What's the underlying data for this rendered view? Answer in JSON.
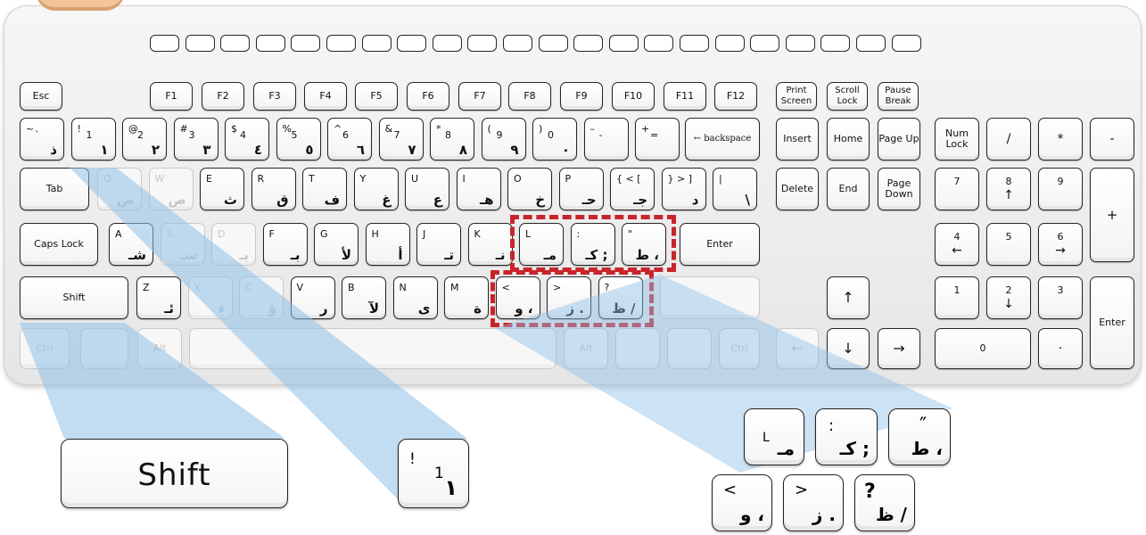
{
  "function_row": [
    "Esc",
    "F1",
    "F2",
    "F3",
    "F4",
    "F5",
    "F6",
    "F7",
    "F8",
    "F9",
    "F10",
    "F11",
    "F12"
  ],
  "system_keys": [
    "Print Screen",
    "Scroll Lock",
    "Pause Break"
  ],
  "number_row": [
    {
      "en": "~",
      "en2": "`",
      "ar": "ذ"
    },
    {
      "en": "!",
      "en2": "1",
      "ar": "١"
    },
    {
      "en": "@",
      "en2": "2",
      "ar": "٢"
    },
    {
      "en": "#",
      "en2": "3",
      "ar": "٣"
    },
    {
      "en": "$",
      "en2": "4",
      "ar": "٤"
    },
    {
      "en": "%",
      "en2": "5",
      "ar": "٥"
    },
    {
      "en": "^",
      "en2": "6",
      "ar": "٦"
    },
    {
      "en": "&",
      "en2": "7",
      "ar": "٧"
    },
    {
      "en": "*",
      "en2": "8",
      "ar": "٨"
    },
    {
      "en": "(",
      "en2": "9",
      "ar": "٩"
    },
    {
      "en": ")",
      "en2": "0",
      "ar": "٠"
    },
    {
      "en": "–",
      "en2": "-",
      "ar": ""
    },
    {
      "en": "+",
      "en2": "=",
      "ar": ""
    }
  ],
  "backspace_label": "backspace",
  "top_row": [
    {
      "en": "Q",
      "ar": "ض",
      "dim": true
    },
    {
      "en": "W",
      "ar": "ص",
      "dim": true
    },
    {
      "en": "E",
      "ar": "ث",
      "dim": false
    },
    {
      "en": "R",
      "ar": "ق",
      "dim": false
    },
    {
      "en": "T",
      "ar": "ف",
      "dim": false
    },
    {
      "en": "Y",
      "ar": "غ",
      "dim": false
    },
    {
      "en": "U",
      "ar": "ع",
      "dim": false
    },
    {
      "en": "I",
      "ar": "هـ",
      "dim": false
    },
    {
      "en": "O",
      "ar": "خ",
      "dim": false
    },
    {
      "en": "P",
      "ar": "حـ",
      "dim": false
    },
    {
      "en": "{  <  [",
      "ar": "جـ",
      "dim": false
    },
    {
      "en": "}  >  ]",
      "ar": "د",
      "dim": false
    },
    {
      "en": "|",
      "ar": "\\",
      "dim": false
    }
  ],
  "home_row": [
    {
      "en": "A",
      "ar": "شـ",
      "dim": false
    },
    {
      "en": "S",
      "ar": "سـ",
      "dim": true
    },
    {
      "en": "D",
      "ar": "يـ",
      "dim": true
    },
    {
      "en": "F",
      "ar": "بـ",
      "dim": false
    },
    {
      "en": "G",
      "ar": "لأ",
      "dim": false
    },
    {
      "en": "H",
      "ar": "أ",
      "dim": false
    },
    {
      "en": "J",
      "ar": "تـ",
      "dim": false
    },
    {
      "en": "K",
      "ar": "نـ",
      "dim": false
    },
    {
      "en": "L",
      "ar": "مـ",
      "dim": false
    },
    {
      "en": ":",
      "ar": "كـ ;",
      "dim": false
    },
    {
      "en": "\"",
      "ar": "ط ،",
      "dim": false
    }
  ],
  "bottom_row": [
    {
      "en": "Z",
      "ar": "ئـ",
      "dim": false
    },
    {
      "en": "X",
      "ar": "ء",
      "dim": true
    },
    {
      "en": "C",
      "ar": "ؤ",
      "dim": true
    },
    {
      "en": "V",
      "ar": "ر",
      "dim": false
    },
    {
      "en": "B",
      "ar": "لآ",
      "dim": false
    },
    {
      "en": "N",
      "ar": "ى",
      "dim": false
    },
    {
      "en": "M",
      "ar": "ة",
      "dim": false
    },
    {
      "en": "<",
      "ar": "و ،",
      "dim": false
    },
    {
      "en": ">",
      "ar": "ز .",
      "dim": false
    },
    {
      "en": "?",
      "ar": "ظ /",
      "dim": false
    }
  ],
  "mods": {
    "esc": "Esc",
    "tab": "Tab",
    "caps": "Caps Lock",
    "shift": "Shift",
    "enter": "Enter",
    "ctrl": "Ctrl",
    "alt": "Alt"
  },
  "nav": {
    "insert": "Insert",
    "home": "Home",
    "page_up": "Page Up",
    "delete": "Delete",
    "end": "End",
    "page_down": "Page Down",
    "up": "↑",
    "down": "↓",
    "right": "→",
    "left": "←"
  },
  "numpad": {
    "num_lock": "Num Lock",
    "slash": "/",
    "star": "*",
    "minus": "-",
    "plus": "+",
    "enter": "Enter",
    "n7": "7",
    "n8": "8",
    "n9": "9",
    "n4": "4",
    "n5": "5",
    "n6": "6",
    "n1": "1",
    "n2": "2",
    "n3": "3",
    "n0": "0",
    "dot": "·",
    "arr_up": "↑",
    "arr_left": "←",
    "arr_right": "→",
    "arr_down": "↓"
  },
  "callouts": {
    "shift_label": "Shift",
    "one_key": {
      "en": "!",
      "en2": "1",
      "ar": "١"
    },
    "l_key": {
      "en": "L",
      "ar": "مـ"
    },
    "colon_key": {
      "en": ":",
      "ar": "كـ ;"
    },
    "quote_key": {
      "en": "″",
      "ar": "ط ،"
    },
    "lt_key": {
      "en": "<",
      "ar": "و ،"
    },
    "gt_key": {
      "en": ">",
      "ar": "ز ."
    },
    "q_key": {
      "en": "?",
      "ar": "ظ /"
    }
  },
  "colors": {
    "highlight": "#c9242b",
    "beam": "#8fbfe8"
  }
}
